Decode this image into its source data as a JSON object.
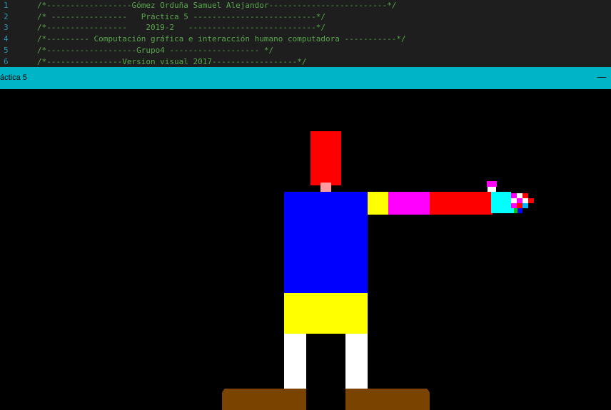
{
  "editor": {
    "lines": [
      {
        "number": "1",
        "text": "/*------------------Gómez Orduña Samuel Alejandor-------------------------*/"
      },
      {
        "number": "2",
        "text": "/* ----------------   Práctica 5 --------------------------*/"
      },
      {
        "number": "3",
        "text": "/*-----------------    2019-2   ---------------------------*/"
      },
      {
        "number": "4",
        "text": "/*--------- Computación gráfica e interacción humano computadora -----------*/"
      },
      {
        "number": "5",
        "text": "/*-------------------Grupo4 ------------------- */"
      },
      {
        "number": "6",
        "text": "/*----------------Version visual 2017------------------*/"
      }
    ]
  },
  "window": {
    "title": "áctica 5",
    "minimize_glyph": "—",
    "titlebar_color": "#00b4c8"
  },
  "scene": {
    "background": "#000000",
    "colors": {
      "hat": "#ff0000",
      "neck": "#ff9aa2",
      "torso": "#0000ff",
      "skirt": "#ffff00",
      "legs": "#ffffff",
      "feet": "#7a4300",
      "shoulder": "#ffff00",
      "upper_arm": "#ff00ff",
      "forearm": "#ff0000",
      "wrist": "#00ffff"
    }
  }
}
